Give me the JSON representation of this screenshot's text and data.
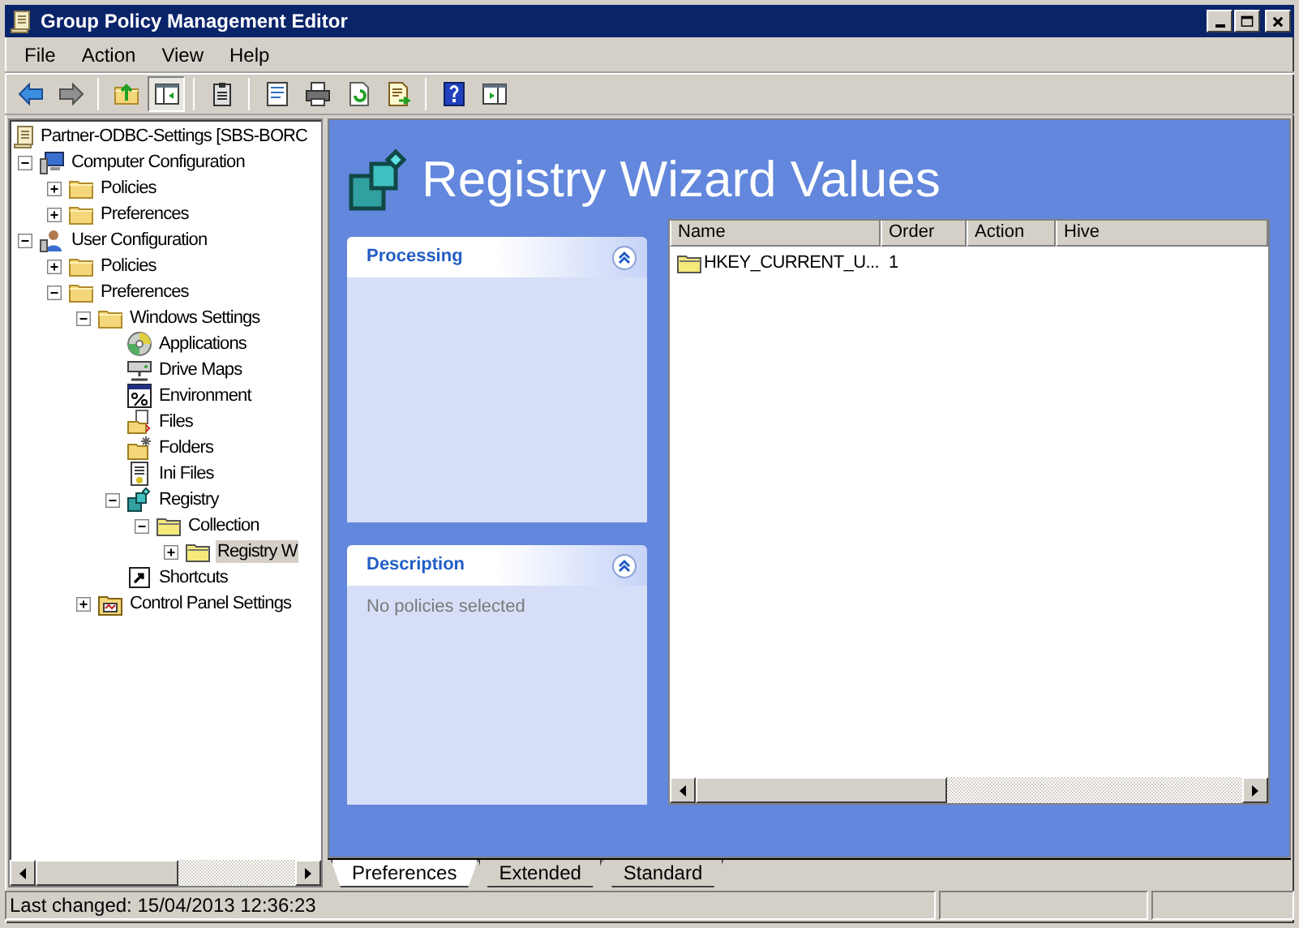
{
  "window": {
    "title": "Group Policy Management Editor"
  },
  "menu": [
    {
      "label": "File"
    },
    {
      "label": "Action"
    },
    {
      "label": "View"
    },
    {
      "label": "Help"
    }
  ],
  "toolbar": [
    {
      "kind": "back",
      "pressed": false
    },
    {
      "kind": "forward",
      "pressed": false
    },
    {
      "kind": "sep"
    },
    {
      "kind": "up",
      "pressed": false
    },
    {
      "kind": "tree",
      "pressed": true
    },
    {
      "kind": "sep"
    },
    {
      "kind": "clipboard",
      "pressed": false
    },
    {
      "kind": "sep"
    },
    {
      "kind": "properties",
      "pressed": false
    },
    {
      "kind": "print",
      "pressed": false
    },
    {
      "kind": "refresh",
      "pressed": false
    },
    {
      "kind": "export",
      "pressed": false
    },
    {
      "kind": "sep"
    },
    {
      "kind": "help",
      "pressed": false
    },
    {
      "kind": "pane",
      "pressed": false
    }
  ],
  "tree": [
    {
      "label": "Partner-ODBC-Settings [SBS-BORC",
      "kind": "gpo",
      "selected": false,
      "children": [
        {
          "label": "Computer Configuration",
          "kind": "computer",
          "expanded": true,
          "selected": false,
          "children": [
            {
              "label": "Policies",
              "kind": "folder",
              "expanded": false,
              "selected": false
            },
            {
              "label": "Preferences",
              "kind": "folder",
              "expanded": false,
              "selected": false
            }
          ]
        },
        {
          "label": "User Configuration",
          "kind": "user",
          "expanded": true,
          "selected": false,
          "children": [
            {
              "label": "Policies",
              "kind": "folder",
              "expanded": false,
              "selected": false
            },
            {
              "label": "Preferences",
              "kind": "folder",
              "expanded": true,
              "selected": false,
              "children": [
                {
                  "label": "Windows Settings",
                  "kind": "folder",
                  "expanded": true,
                  "selected": false,
                  "children": [
                    {
                      "label": "Applications",
                      "kind": "disc",
                      "selected": false
                    },
                    {
                      "label": "Drive Maps",
                      "kind": "drive",
                      "selected": false
                    },
                    {
                      "label": "Environment",
                      "kind": "environment",
                      "selected": false
                    },
                    {
                      "label": "Files",
                      "kind": "files",
                      "selected": false
                    },
                    {
                      "label": "Folders",
                      "kind": "folders",
                      "selected": false
                    },
                    {
                      "label": "Ini Files",
                      "kind": "ini",
                      "selected": false
                    },
                    {
                      "label": "Registry",
                      "kind": "registry",
                      "expanded": true,
                      "selected": false,
                      "children": [
                        {
                          "label": "Collection",
                          "kind": "collection",
                          "expanded": true,
                          "selected": false,
                          "children": [
                            {
                              "label": "Registry W",
                              "kind": "collection",
                              "expanded": false,
                              "selected": true
                            }
                          ]
                        }
                      ]
                    },
                    {
                      "label": "Shortcuts",
                      "kind": "shortcut",
                      "selected": false
                    }
                  ]
                },
                {
                  "label": "Control Panel Settings",
                  "kind": "control",
                  "expanded": false,
                  "selected": false
                }
              ]
            }
          ]
        }
      ]
    }
  ],
  "details": {
    "title": "Registry Wizard Values",
    "panels": [
      {
        "title": "Processing"
      },
      {
        "title": "Description",
        "text": "No policies selected"
      }
    ],
    "list": {
      "columns": [
        "Name",
        "Order",
        "Action",
        "Hive"
      ],
      "rows": [
        {
          "kind": "folder",
          "cells": [
            "HKEY_CURRENT_U...",
            "1"
          ]
        }
      ]
    }
  },
  "tabs": [
    {
      "label": "Preferences",
      "selected": true
    },
    {
      "label": "Extended",
      "selected": false
    },
    {
      "label": "Standard",
      "selected": false
    }
  ],
  "status_bar": {
    "text": "Last changed: 15/04/2013 12:36:23"
  }
}
